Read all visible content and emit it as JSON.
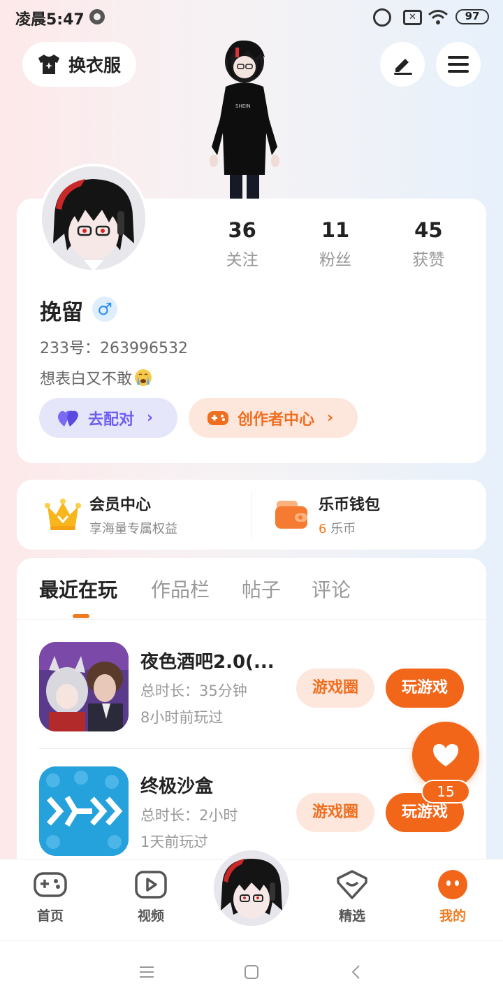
{
  "status_bar": {
    "time": "凌晨5:47",
    "battery": "97"
  },
  "top": {
    "outfit_label": "换衣服",
    "icons": [
      "tshirt-icon",
      "pen-icon",
      "menu-icon"
    ]
  },
  "profile": {
    "stats": [
      {
        "value": "36",
        "label": "关注"
      },
      {
        "value": "11",
        "label": "粉丝"
      },
      {
        "value": "45",
        "label": "获赞"
      }
    ],
    "username": "挽留",
    "gender_symbol": "♂",
    "user_id": "233号：263996532",
    "bio": "想表白又不敢",
    "match_label": "去配对",
    "creator_label": "创作者中心"
  },
  "member": {
    "title": "会员中心",
    "subtitle": "享海量专属权益"
  },
  "wallet": {
    "title": "乐币钱包",
    "coin_amount": "6",
    "coin_unit": "乐币"
  },
  "tabs": [
    "最近在玩",
    "作品栏",
    "帖子",
    "评论"
  ],
  "games": [
    {
      "name": "夜色酒吧2.0(...",
      "duration": "总时长：35分钟",
      "last_played": "8小时前玩过",
      "circle_label": "游戏圈",
      "play_label": "玩游戏"
    },
    {
      "name": "终极沙盒",
      "duration": "总时长：2小时",
      "last_played": "1天前玩过",
      "circle_label": "游戏圈",
      "play_label": "玩游戏"
    }
  ],
  "like_count": "15",
  "bottom_nav": [
    {
      "label": "首页",
      "icon": "gamepad-icon"
    },
    {
      "label": "视频",
      "icon": "video-play-icon"
    },
    {
      "label": "精选",
      "icon": "heart-box-icon"
    },
    {
      "label": "我的",
      "icon": "face-icon"
    }
  ],
  "colors": {
    "accent": "#f2661a",
    "match": "#6d5ef2",
    "gender": "#2b8ff0"
  }
}
